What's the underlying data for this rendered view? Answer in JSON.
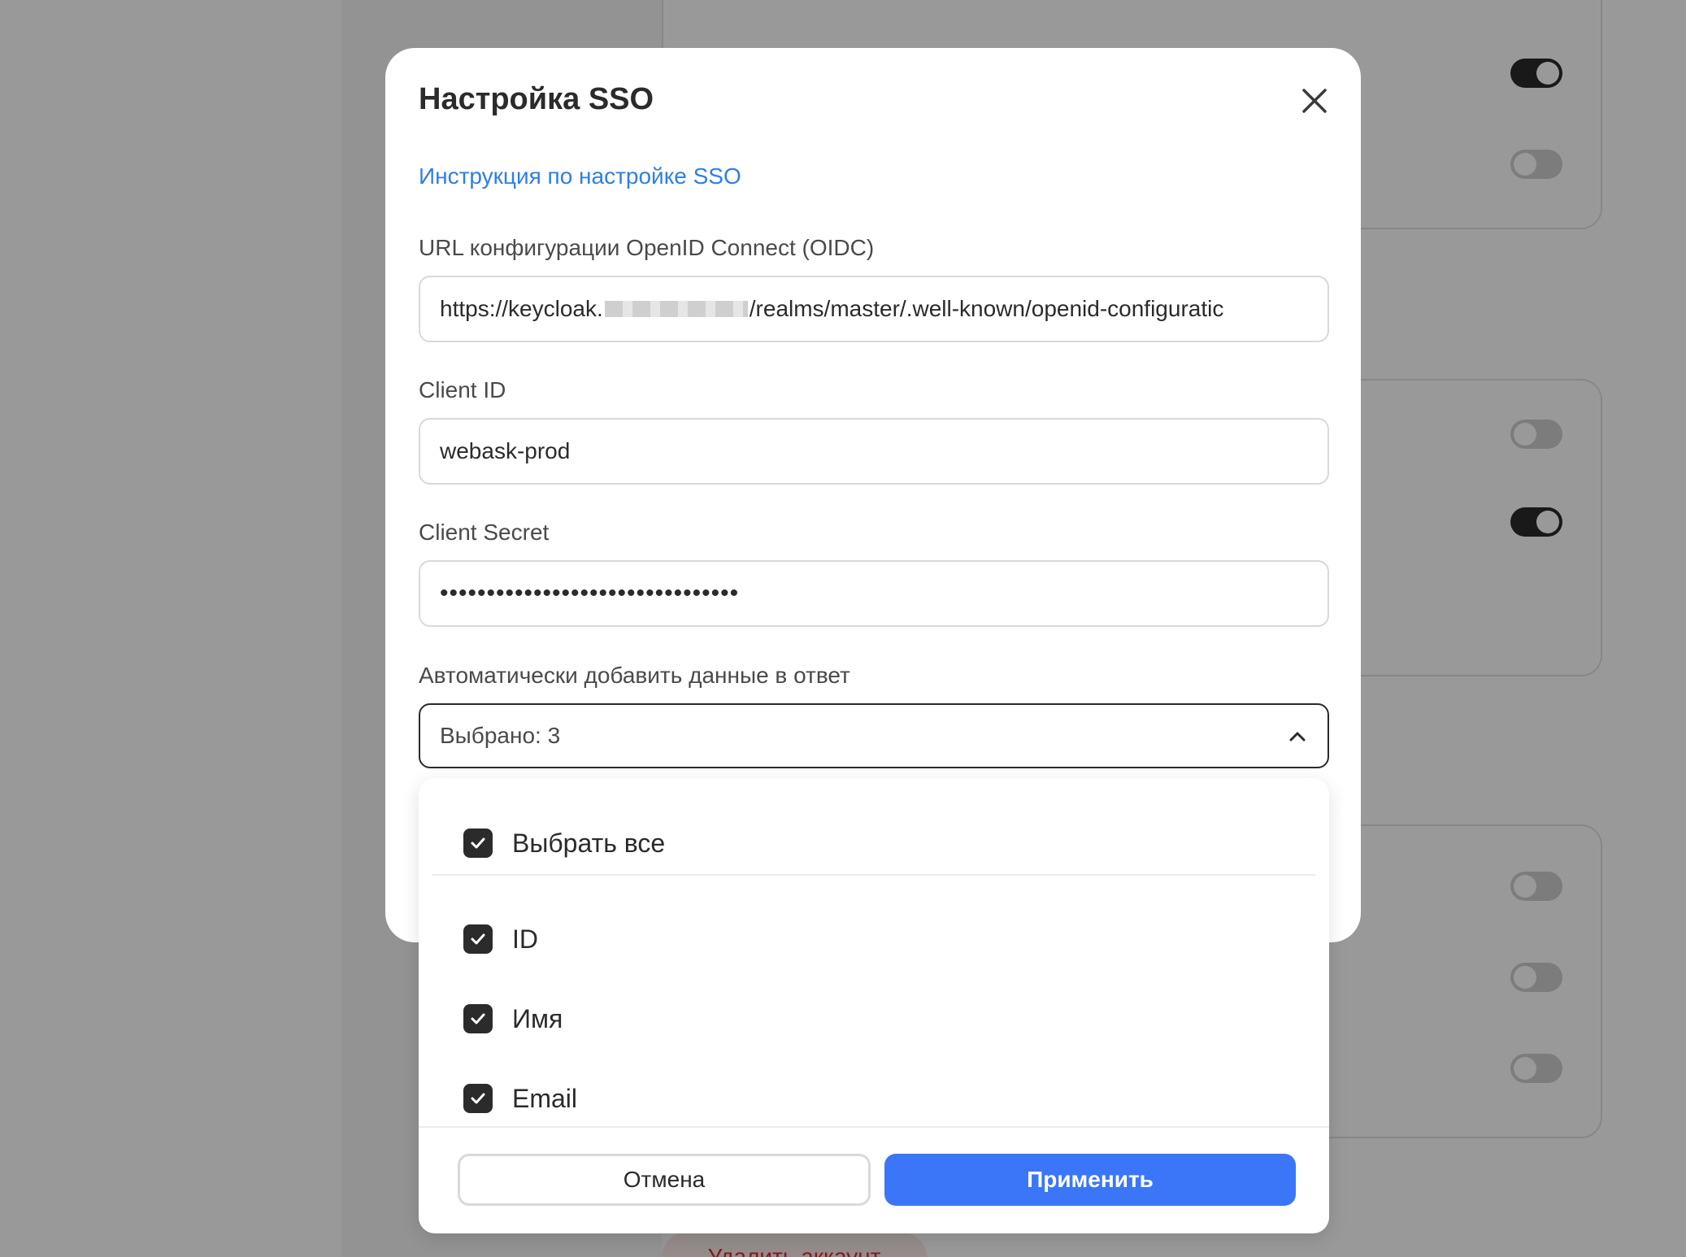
{
  "background": {
    "delete_account_label": "Удалить аккаунт",
    "toggles": [
      true,
      false,
      false,
      true,
      false,
      false,
      false
    ]
  },
  "modal": {
    "title": "Настройка SSO",
    "instruction_link": "Инструкция по настройке SSO",
    "oidc_url": {
      "label": "URL конфигурации OpenID Connect (OIDC)",
      "value_prefix": "https://keycloak.",
      "value_suffix": "/realms/master/.well-known/openid-configuratic"
    },
    "client_id": {
      "label": "Client ID",
      "value": "webask-prod"
    },
    "client_secret": {
      "label": "Client Secret",
      "value": "••••••••••••••••••••••••••••••••"
    },
    "auto_add": {
      "label": "Автоматически добавить данные в ответ",
      "selected_text": "Выбрано: 3"
    }
  },
  "dropdown": {
    "select_all": {
      "label": "Выбрать все",
      "checked": true
    },
    "options": [
      {
        "label": "ID",
        "checked": true
      },
      {
        "label": "Имя",
        "checked": true
      },
      {
        "label": "Email",
        "checked": true
      }
    ],
    "cancel_label": "Отмена",
    "apply_label": "Применить"
  },
  "colors": {
    "accent": "#3a76f7",
    "link": "#2f7ee8",
    "checkbox": "#2b2b2b",
    "danger": "#d32f2f"
  }
}
